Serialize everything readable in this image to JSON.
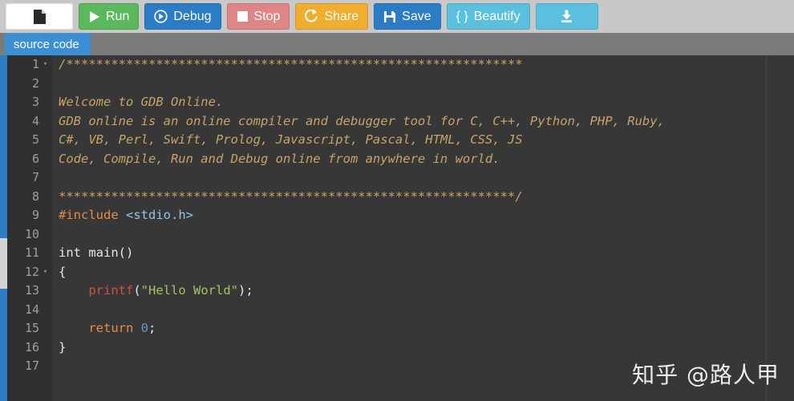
{
  "toolbar": {
    "buttons": [
      {
        "name": "new-file",
        "label": "",
        "icon": "file-icon"
      },
      {
        "name": "run",
        "label": "Run",
        "icon": "play-icon"
      },
      {
        "name": "debug",
        "label": "Debug",
        "icon": "debug-circle-icon"
      },
      {
        "name": "stop",
        "label": "Stop",
        "icon": "stop-square-icon"
      },
      {
        "name": "share",
        "label": "Share",
        "icon": "share-icon"
      },
      {
        "name": "save",
        "label": "Save",
        "icon": "floppy-icon"
      },
      {
        "name": "beautify",
        "label": "Beautify",
        "icon": "braces-icon"
      },
      {
        "name": "download",
        "label": "",
        "icon": "download-icon"
      }
    ],
    "beautify_prefix": "{ }",
    "colors": {
      "bar": "#c8c8c8",
      "run": "#5cb85c",
      "debug": "#2b7cc4",
      "stop": "#e08585",
      "share": "#f0ad2e",
      "save": "#2b7cc4",
      "beautify": "#5bc0de",
      "download": "#5bc0de"
    }
  },
  "tabs": {
    "active_label": "source code",
    "active_color": "#3d8fd4",
    "bar_color": "#7b7b7b"
  },
  "editor": {
    "background": "#373737",
    "gutter_background": "#303030",
    "line_number_color": "#9aa0a0",
    "fold_glyph": "▾",
    "line_numbers": [
      1,
      2,
      3,
      4,
      5,
      6,
      7,
      8,
      9,
      10,
      11,
      12,
      13,
      14,
      15,
      16,
      17
    ],
    "fold_lines": [
      1,
      12
    ],
    "lines": [
      {
        "n": 1,
        "tokens": [
          {
            "t": "/*************************************************************",
            "c": "comment"
          }
        ]
      },
      {
        "n": 2,
        "tokens": [
          {
            "t": "",
            "c": "plain"
          }
        ]
      },
      {
        "n": 3,
        "tokens": [
          {
            "t": "Welcome to GDB Online.",
            "c": "comment"
          }
        ]
      },
      {
        "n": 4,
        "tokens": [
          {
            "t": "GDB online is an online compiler and debugger tool for C, C++, Python, PHP, Ruby,",
            "c": "comment"
          }
        ]
      },
      {
        "n": 5,
        "tokens": [
          {
            "t": "C#, VB, Perl, Swift, Prolog, Javascript, Pascal, HTML, CSS, JS",
            "c": "comment"
          }
        ]
      },
      {
        "n": 6,
        "tokens": [
          {
            "t": "Code, Compile, Run and Debug online from anywhere in world.",
            "c": "comment"
          }
        ]
      },
      {
        "n": 7,
        "tokens": [
          {
            "t": "",
            "c": "plain"
          }
        ]
      },
      {
        "n": 8,
        "tokens": [
          {
            "t": "*************************************************************/",
            "c": "comment"
          }
        ]
      },
      {
        "n": 9,
        "tokens": [
          {
            "t": "#include ",
            "c": "pre"
          },
          {
            "t": "<stdio.h>",
            "c": "inc"
          }
        ]
      },
      {
        "n": 10,
        "tokens": [
          {
            "t": "",
            "c": "plain"
          }
        ]
      },
      {
        "n": 11,
        "tokens": [
          {
            "t": "int main()",
            "c": "plain"
          }
        ]
      },
      {
        "n": 12,
        "tokens": [
          {
            "t": "{",
            "c": "plain"
          }
        ]
      },
      {
        "n": 13,
        "tokens": [
          {
            "t": "    ",
            "c": "plain"
          },
          {
            "t": "printf",
            "c": "fn"
          },
          {
            "t": "(",
            "c": "plain"
          },
          {
            "t": "\"Hello World\"",
            "c": "str"
          },
          {
            "t": ");",
            "c": "plain"
          }
        ]
      },
      {
        "n": 14,
        "tokens": [
          {
            "t": "",
            "c": "plain"
          }
        ]
      },
      {
        "n": 15,
        "tokens": [
          {
            "t": "    ",
            "c": "plain"
          },
          {
            "t": "return",
            "c": "kw"
          },
          {
            "t": " ",
            "c": "plain"
          },
          {
            "t": "0",
            "c": "num"
          },
          {
            "t": ";",
            "c": "plain"
          }
        ]
      },
      {
        "n": 16,
        "tokens": [
          {
            "t": "}",
            "c": "plain"
          }
        ]
      },
      {
        "n": 17,
        "tokens": [
          {
            "t": "",
            "c": "plain"
          }
        ]
      }
    ],
    "syntax_colors": {
      "comment": "#c8a36a",
      "preprocessor": "#e08c4a",
      "include_path": "#93c5e8",
      "keyword": "#e08c4a",
      "function": "#c8544a",
      "string": "#a5c261",
      "number": "#6897bb",
      "plain": "#e8e8e8"
    }
  },
  "scrollbar": {
    "track_color": "#2b7cc4",
    "thumb_color": "#d4d4d4"
  },
  "watermark": {
    "text": "知乎 @路人甲"
  }
}
